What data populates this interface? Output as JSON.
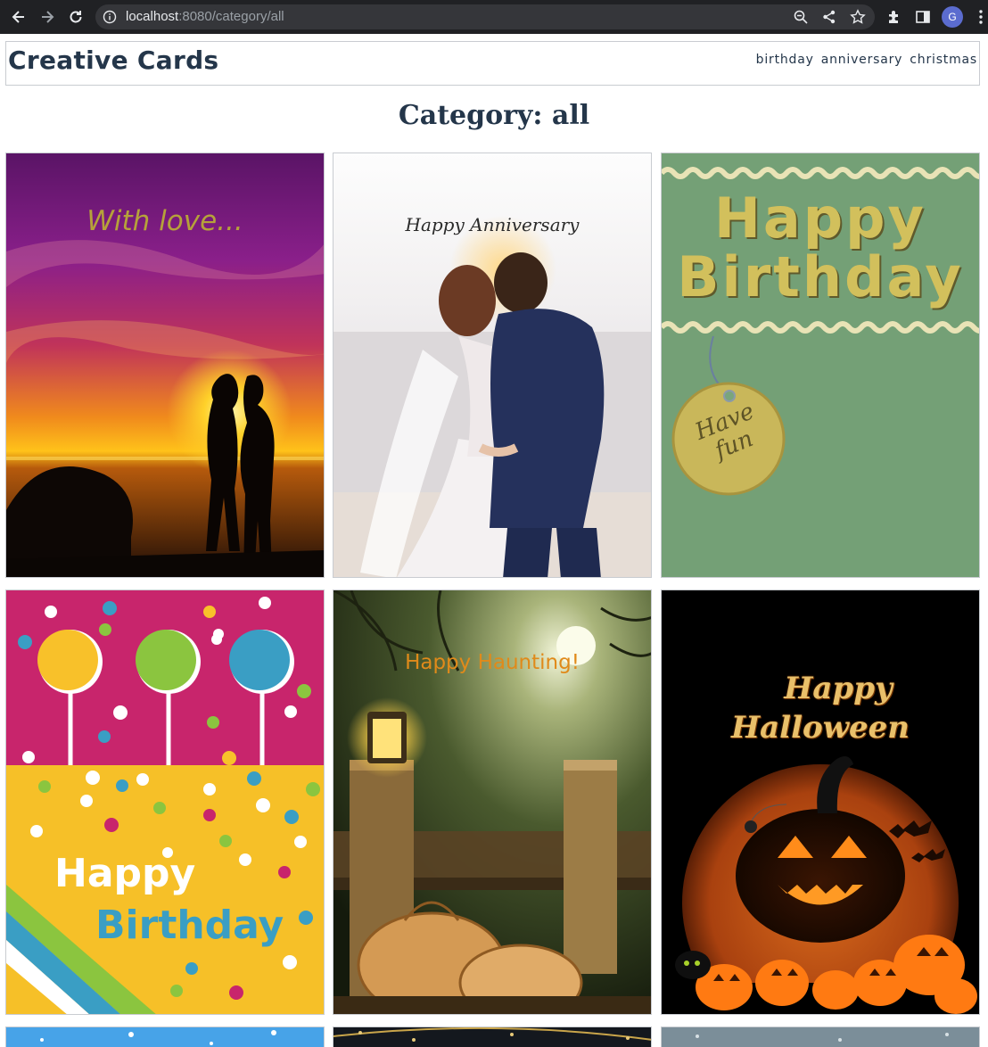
{
  "browser": {
    "url_host": "localhost",
    "url_rest": ":8080/category/all",
    "profile_initial": "G"
  },
  "site": {
    "brand": "Creative Cards",
    "nav": [
      "birthday",
      "anniversary",
      "christmas"
    ]
  },
  "page": {
    "title": "Category: all"
  },
  "cards": [
    {
      "text": "With love..."
    },
    {
      "text": "Happy Anniversary"
    },
    {
      "text_line1": "Happy",
      "text_line2": "Birthday",
      "tag": "Have fun"
    },
    {
      "text_line1": "Happy",
      "text_line2": "Birthday"
    },
    {
      "text": "Happy Haunting!"
    },
    {
      "text_line1": "Happy",
      "text_line2": "Halloween"
    }
  ],
  "colors": {
    "brand": "#24364a",
    "chrome": "#202124",
    "omnibox": "#35363a"
  }
}
